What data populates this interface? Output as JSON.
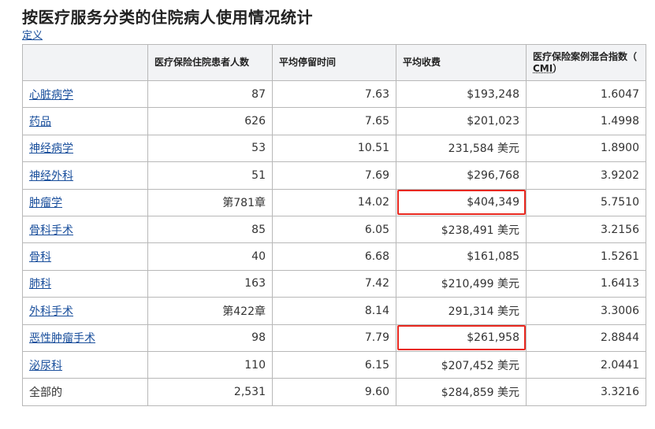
{
  "page": {
    "title": "按医疗服务分类的住院病人使用情况统计",
    "definition_link": "定义"
  },
  "table": {
    "headers": [
      "",
      "医疗保险住院患者人数",
      "平均停留时间",
      "平均收费",
      "医疗保险案例混合指数（",
      "CMI",
      "）"
    ],
    "rows": [
      {
        "category": "心脏病学",
        "patients": "87",
        "stay": "7.63",
        "charge": "$193,248",
        "cmi": "1.6047"
      },
      {
        "category": "药品",
        "patients": "626",
        "stay": "7.65",
        "charge": "$201,023",
        "cmi": "1.4998"
      },
      {
        "category": "神经病学",
        "patients": "53",
        "stay": "10.51",
        "charge": "231,584 美元",
        "cmi": "1.8900"
      },
      {
        "category": "神经外科",
        "patients": "51",
        "stay": "7.69",
        "charge": "$296,768",
        "cmi": "3.9202"
      },
      {
        "category": "肿瘤学",
        "patients": "第781章",
        "stay": "14.02",
        "charge": "$404,349",
        "cmi": "5.7510"
      },
      {
        "category": "骨科手术",
        "patients": "85",
        "stay": "6.05",
        "charge": "$238,491 美元",
        "cmi": "3.2156"
      },
      {
        "category": "骨科",
        "patients": "40",
        "stay": "6.68",
        "charge": "$161,085",
        "cmi": "1.5261"
      },
      {
        "category": "肺科",
        "patients": "163",
        "stay": "7.42",
        "charge": "$210,499 美元",
        "cmi": "1.6413"
      },
      {
        "category": "外科手术",
        "patients": "第422章",
        "stay": "8.14",
        "charge": "291,314 美元",
        "cmi": "3.3006"
      },
      {
        "category": "恶性肿瘤手术",
        "patients": "98",
        "stay": "7.79",
        "charge": "$261,958",
        "cmi": "2.8844"
      },
      {
        "category": "泌尿科",
        "patients": "110",
        "stay": "6.15",
        "charge": "$207,452 美元",
        "cmi": "2.0441"
      },
      {
        "category": "全部的",
        "patients": "2,531",
        "stay": "9.60",
        "charge": "$284,859 美元",
        "cmi": "3.3216"
      }
    ]
  },
  "highlight_color": "#e8281f",
  "link_color": "#1a4f9c"
}
